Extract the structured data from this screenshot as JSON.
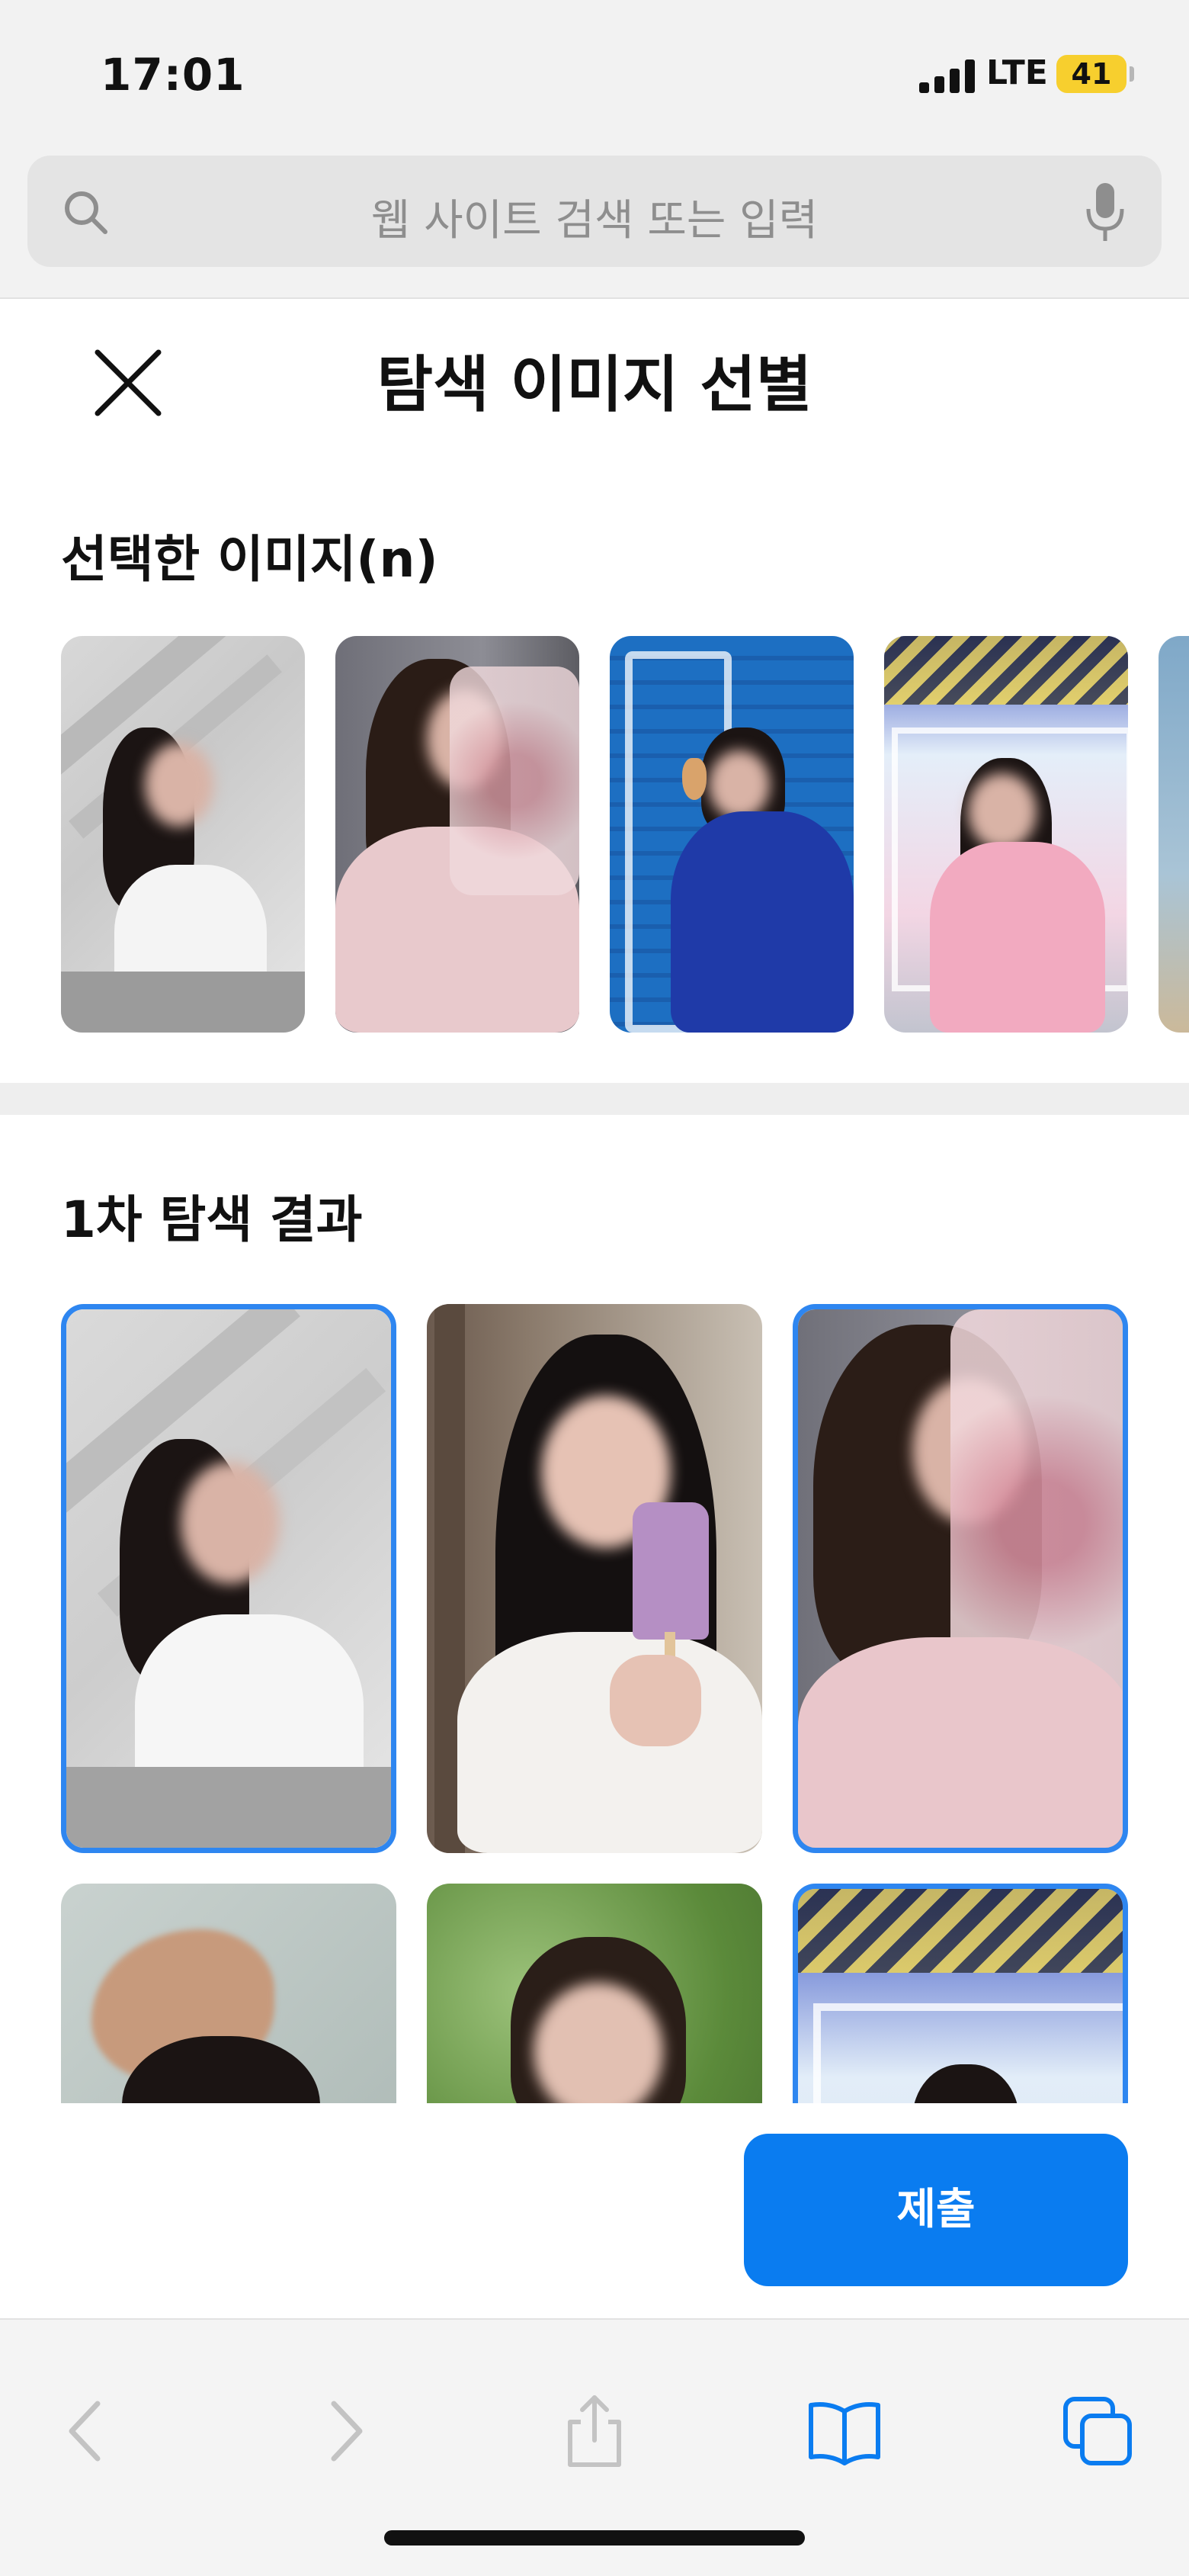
{
  "status_bar": {
    "time": "17:01",
    "network": "LTE",
    "battery": "41",
    "battery_color": "#f7cf2e"
  },
  "browser": {
    "search_placeholder": "웹 사이트 검색 또는 입력",
    "icons": [
      "search-icon",
      "microphone-icon"
    ]
  },
  "modal": {
    "title": "탐색 이미지 선별",
    "close_icon": "close-icon"
  },
  "selected_section": {
    "title": "선택한 이미지(n)",
    "thumbnails": [
      {
        "description": "woman in white blouse against grey wall"
      },
      {
        "description": "woman in floral top leaning on railing"
      },
      {
        "description": "woman in blue jacket with ice cream cone"
      },
      {
        "description": "woman in pink sweater by claw machine"
      },
      {
        "description": "partially visible image"
      }
    ]
  },
  "results_section": {
    "title": "1차 탐색 결과",
    "items": [
      {
        "selected": true
      },
      {
        "selected": false
      },
      {
        "selected": true
      },
      {
        "selected": false
      },
      {
        "selected": false
      },
      {
        "selected": true
      }
    ]
  },
  "submit_label": "제출",
  "accent_color": "#0a7cf0",
  "selection_border_color": "#2e86f0",
  "toolbar": {
    "icons": [
      "back-icon",
      "forward-icon",
      "share-icon",
      "bookmarks-icon",
      "tabs-icon"
    ]
  }
}
